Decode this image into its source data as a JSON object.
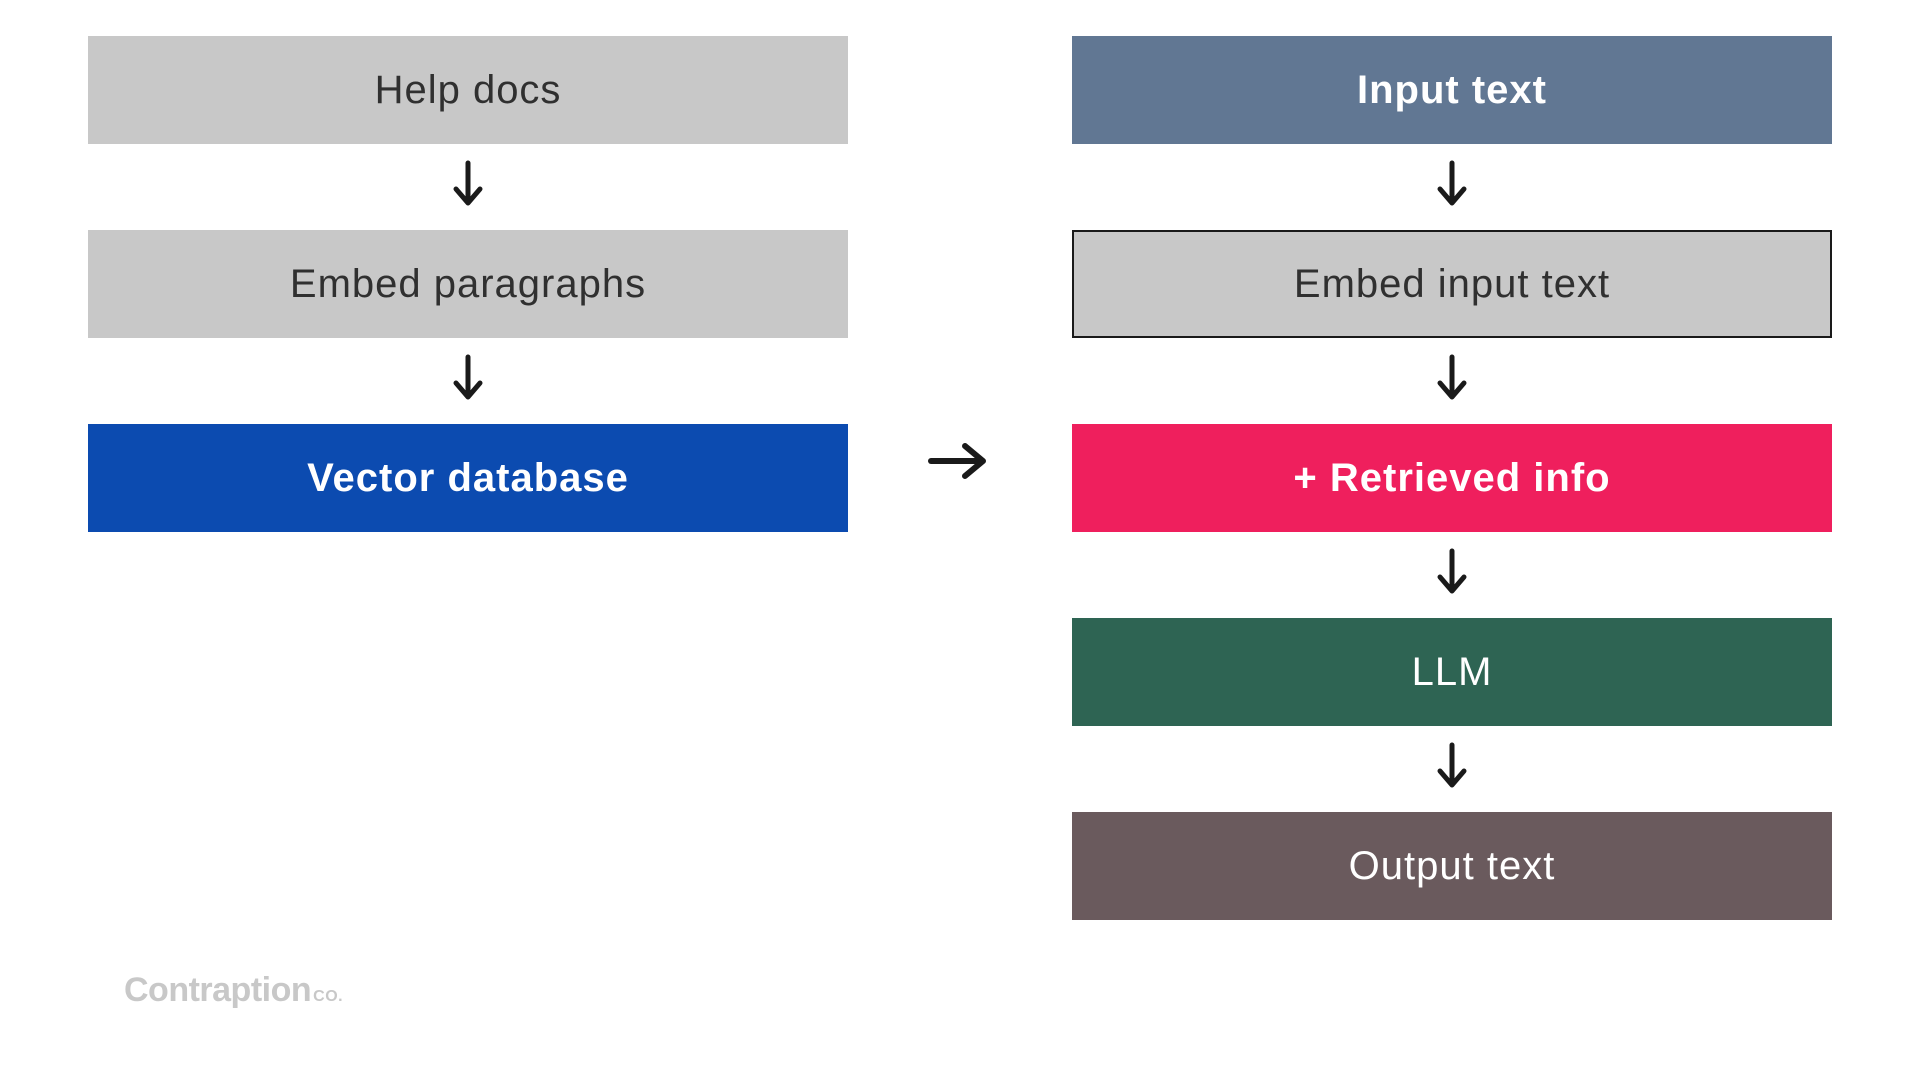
{
  "left_column": {
    "boxes": [
      {
        "label": "Help docs",
        "style": "gray",
        "outlined": false
      },
      {
        "label": "Embed paragraphs",
        "style": "gray",
        "outlined": false
      },
      {
        "label": "Vector database",
        "style": "blue",
        "outlined": false
      }
    ]
  },
  "right_column": {
    "boxes": [
      {
        "label": "Input text",
        "style": "slate",
        "outlined": false
      },
      {
        "label": "Embed input text",
        "style": "gray",
        "outlined": true
      },
      {
        "label": "+ Retrieved info",
        "style": "pink",
        "outlined": false
      },
      {
        "label": "LLM",
        "style": "green",
        "outlined": false
      },
      {
        "label": "Output text",
        "style": "mauve",
        "outlined": false
      }
    ]
  },
  "connector": {
    "direction": "right"
  },
  "footer": {
    "brand": "Contraption",
    "suffix": "co."
  },
  "colors": {
    "gray_box": "#c8c8c8",
    "gray_text": "#303030",
    "blue_box": "#0c4bb0",
    "slate_box": "#617793",
    "pink_box": "#ef1f5d",
    "green_box": "#2e6453",
    "mauve_box": "#6a5a5d",
    "arrow": "#1a1a1a",
    "footer_gray": "#c8c8c8"
  }
}
